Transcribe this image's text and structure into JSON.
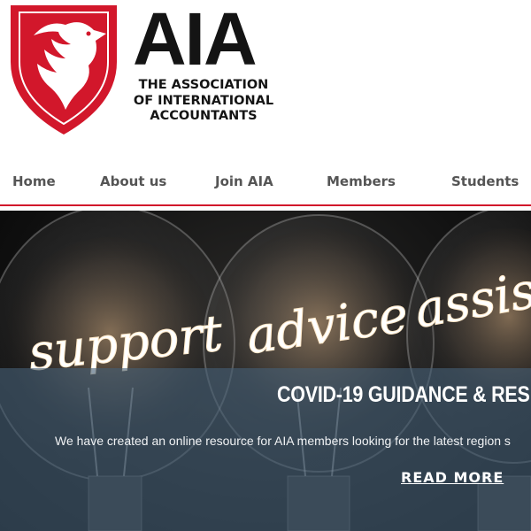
{
  "brand": {
    "acronym": "AIA",
    "name_lines": [
      "THE ASSOCIATION",
      "OF INTERNATIONAL",
      "ACCOUNTANTS"
    ],
    "shield_color": "#d2172b"
  },
  "nav": {
    "items": [
      {
        "label": "Home"
      },
      {
        "label": "About us"
      },
      {
        "label": "Join AIA"
      },
      {
        "label": "Members"
      },
      {
        "label": "Students"
      }
    ],
    "underline_color": "#d2172b"
  },
  "hero": {
    "bulb_words": [
      "support",
      "advice",
      "assis"
    ],
    "title": "COVID-19 GUIDANCE & RES",
    "text": "We have created an online resource for AIA members looking for the latest region s",
    "cta_label": "READ MORE"
  }
}
